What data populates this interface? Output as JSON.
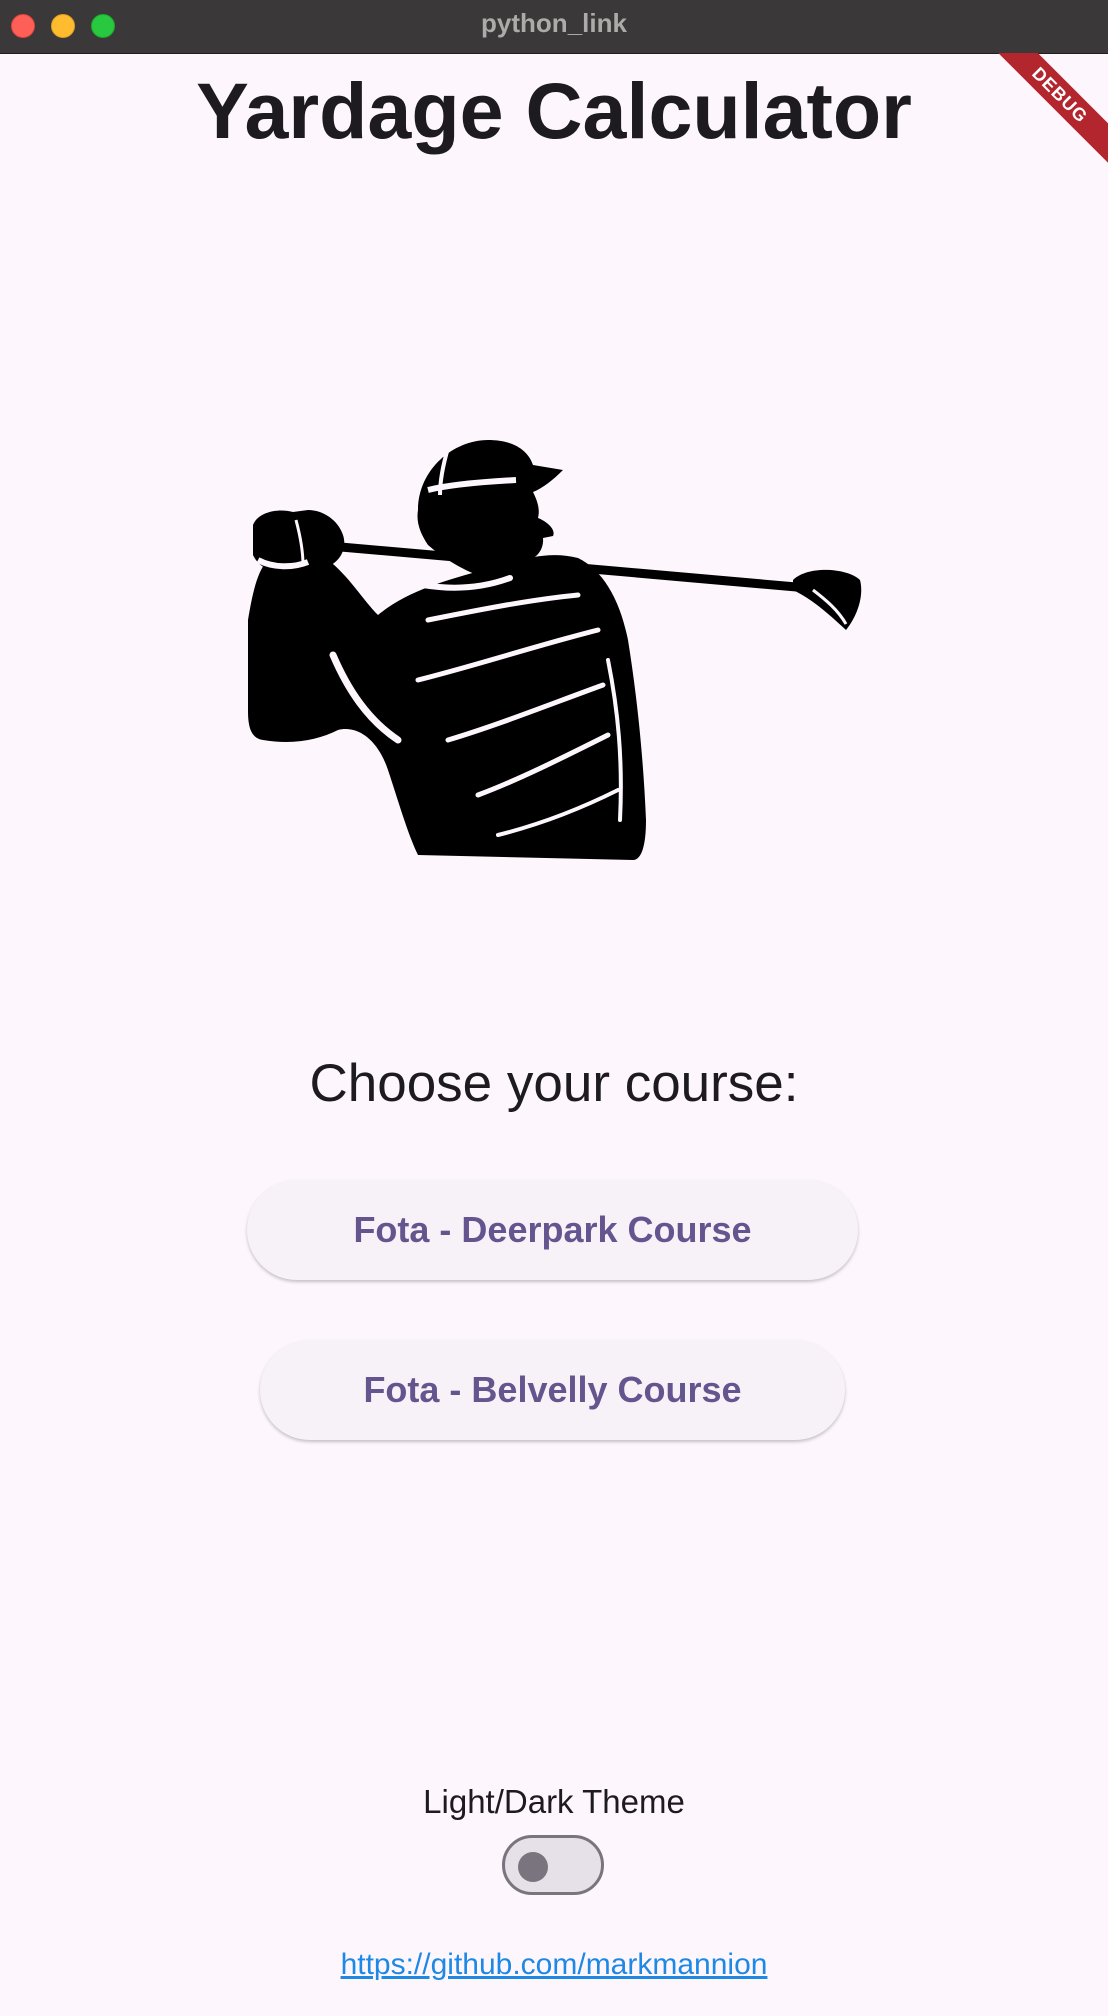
{
  "window": {
    "title": "python_link"
  },
  "debug_banner": {
    "label": "DEBUG",
    "color": "#b3262d"
  },
  "app": {
    "title": "Yardage Calculator",
    "hero_image_icon": "golfer-swing-icon",
    "subtitle": "Choose your course:",
    "courses": [
      {
        "label": "Fota - Deerpark Course"
      },
      {
        "label": "Fota - Belvelly Course"
      }
    ],
    "theme": {
      "label": "Light/Dark Theme",
      "enabled": false
    },
    "footer_link": "https://github.com/markmannion"
  },
  "colors": {
    "background": "#fdf7fd",
    "button_text": "#65558f",
    "button_bg": "#f6f2f7",
    "link": "#1e88e5",
    "titlebar": "#3a3838"
  }
}
